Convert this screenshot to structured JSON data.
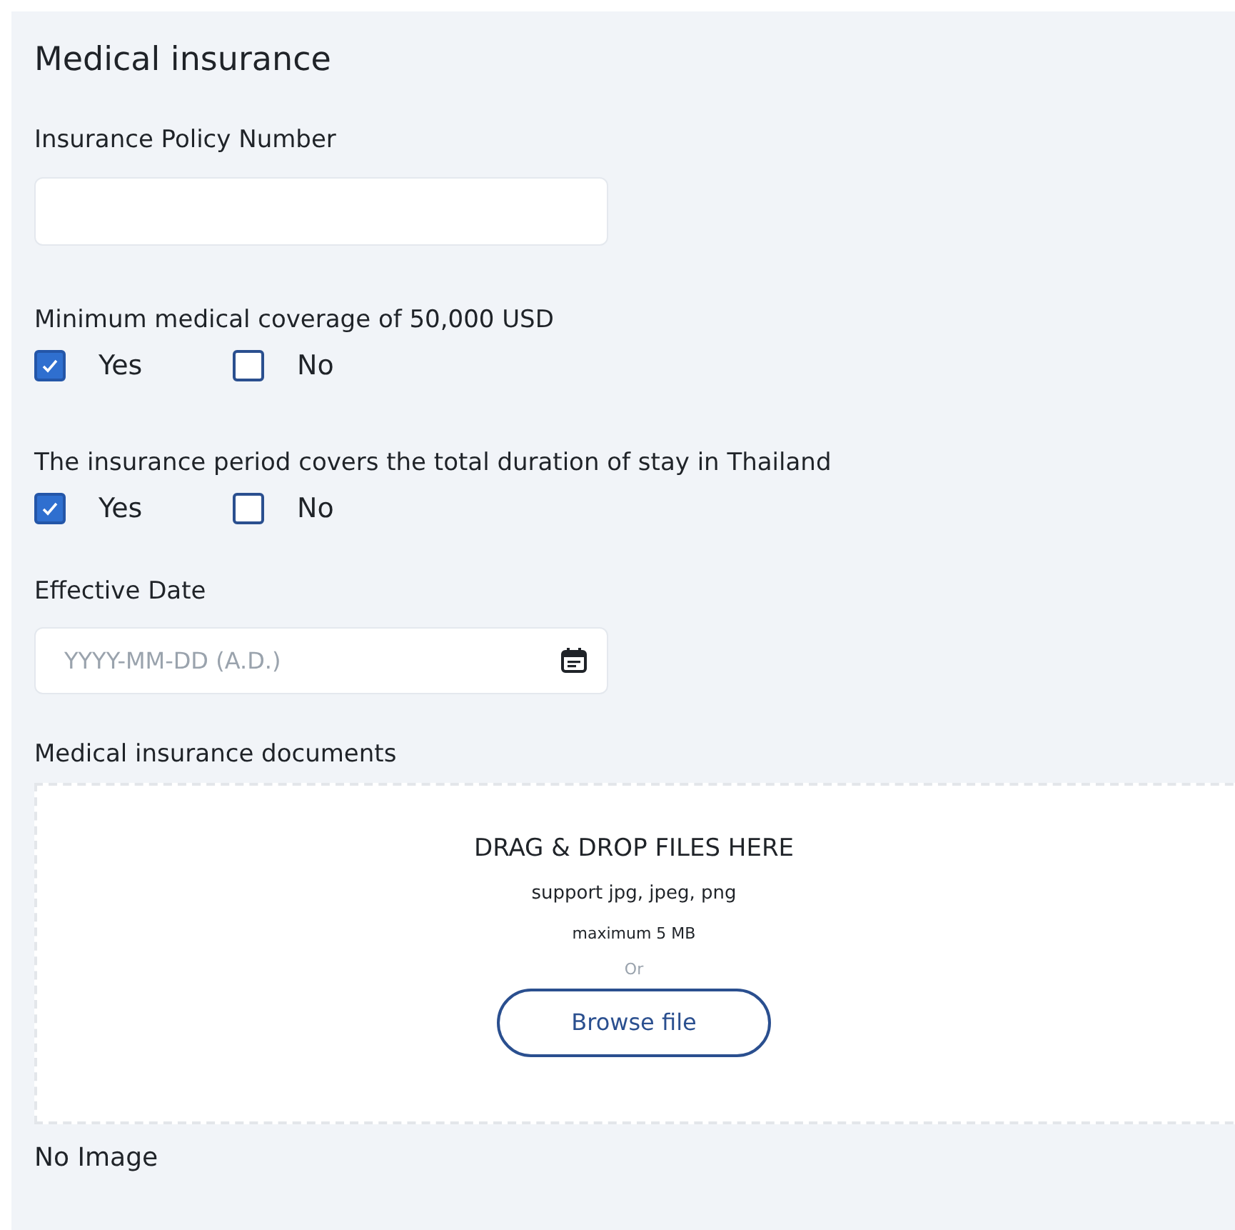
{
  "title": "Medical insurance",
  "policy_number": {
    "label": "Insurance Policy Number"
  },
  "questions": [
    {
      "label": "Minimum medical coverage of 50,000 USD",
      "options": [
        {
          "label": "Yes",
          "checked": true
        },
        {
          "label": "No",
          "checked": false
        }
      ]
    },
    {
      "label": "The insurance period covers the total duration of stay in Thailand",
      "options": [
        {
          "label": "Yes",
          "checked": true
        },
        {
          "label": "No",
          "checked": false
        }
      ]
    }
  ],
  "effective_date": {
    "label": "Effective Date",
    "placeholder": "YYYY-MM-DD (A.D.)"
  },
  "documents": {
    "label": "Medical insurance documents",
    "heading": "DRAG & DROP FILES HERE",
    "formats": "support jpg, jpeg, png",
    "max_size": "maximum 5 MB",
    "or": "Or",
    "button": "Browse file"
  },
  "preview": "No Image"
}
